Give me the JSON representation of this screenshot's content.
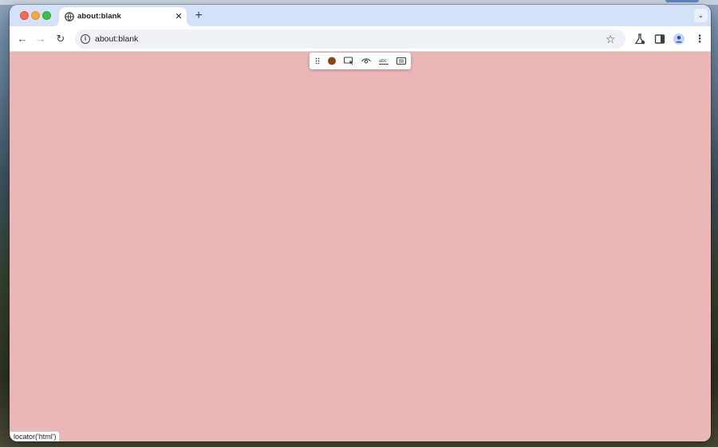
{
  "browser": {
    "tab": {
      "title": "about:blank",
      "close_glyph": "✕",
      "favicon": "globe-icon"
    },
    "new_tab_glyph": "+",
    "tab_search_glyph": "⌄",
    "address_bar": {
      "url": "about:blank",
      "security_icon": "info-icon"
    },
    "nav": {
      "back_glyph": "←",
      "forward_glyph": "→",
      "reload_glyph": "↻"
    },
    "menu_glyph": "⋮",
    "star_glyph": "☆"
  },
  "page": {
    "background_color": "#ebb6b6",
    "inspector_toolbar": {
      "items": [
        "drag-handle-icon",
        "record-icon",
        "pick-locator-icon",
        "assert-visibility-icon",
        "assert-text-icon",
        "assert-value-icon"
      ],
      "record_color": "#8b4513"
    },
    "status_tooltip": "locator('html')"
  },
  "colors": {
    "titlebar": "#d3e2f8",
    "close": "#f46a57",
    "minimize": "#f4a93a",
    "maximize": "#3fc04b"
  }
}
